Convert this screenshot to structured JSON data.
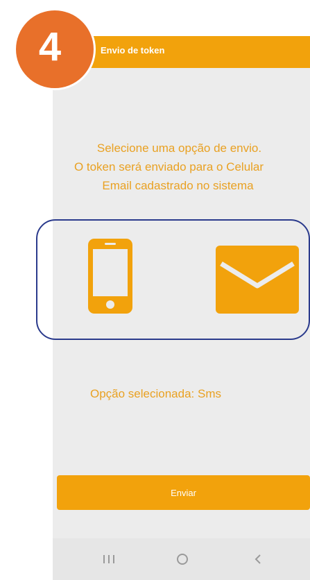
{
  "step": {
    "number": "4"
  },
  "appbar": {
    "title": "Envio de token"
  },
  "instructions": {
    "line1": "Selecione uma opção de envio.",
    "line2": "O token será enviado para o Celular",
    "line3": "Email cadastrado no sistema"
  },
  "options": {
    "sms_icon": "smartphone-icon",
    "email_icon": "envelope-icon"
  },
  "selection": {
    "label": "Opção selecionada: Sms"
  },
  "actions": {
    "send_label": "Enviar"
  },
  "navbar": {
    "recents_icon": "recents-icon",
    "home_icon": "home-icon",
    "back_icon": "back-icon"
  },
  "colors": {
    "accent": "#f2a20c",
    "badge": "#e8702a",
    "text": "#e9a122",
    "outline": "#2a3a8c",
    "background": "#ececec"
  }
}
